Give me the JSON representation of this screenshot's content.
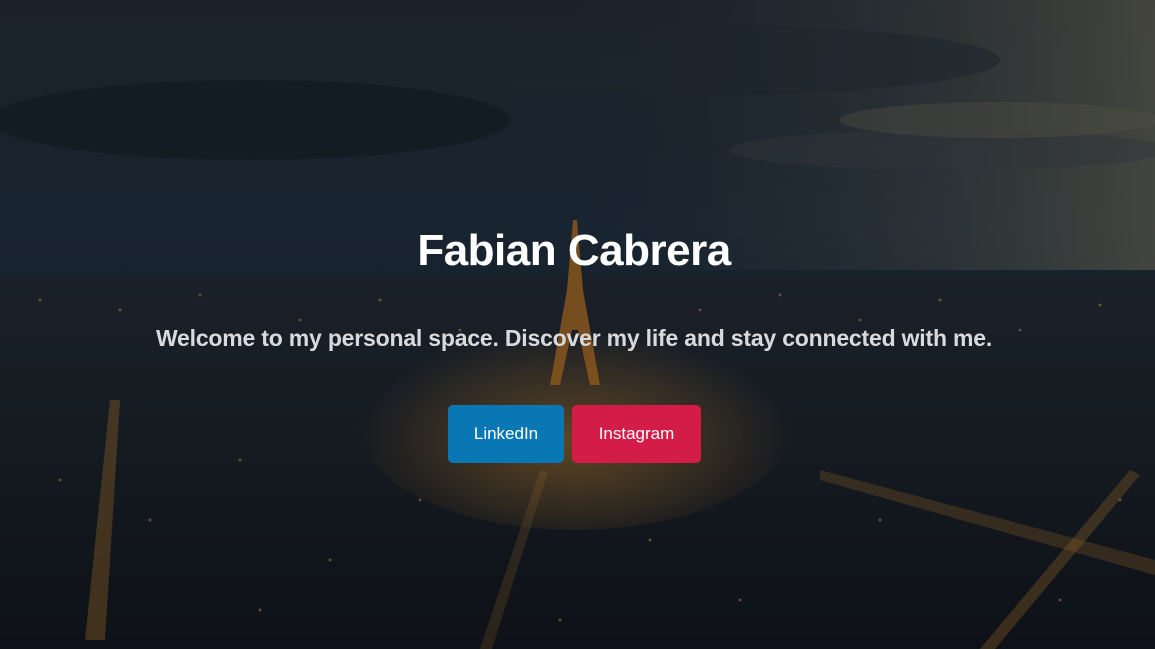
{
  "hero": {
    "name": "Fabian Cabrera",
    "tagline": "Welcome to my personal space. Discover my life and stay connected with me."
  },
  "buttons": {
    "linkedin": {
      "label": "LinkedIn",
      "color": "#0a77b5"
    },
    "instagram": {
      "label": "Instagram",
      "color": "#d41c49"
    }
  },
  "background": {
    "description_icon": "city-night-skyline-icon",
    "sky_color": "#2b3a48",
    "city_color": "#1d2530",
    "light_color": "#f2a43a"
  }
}
